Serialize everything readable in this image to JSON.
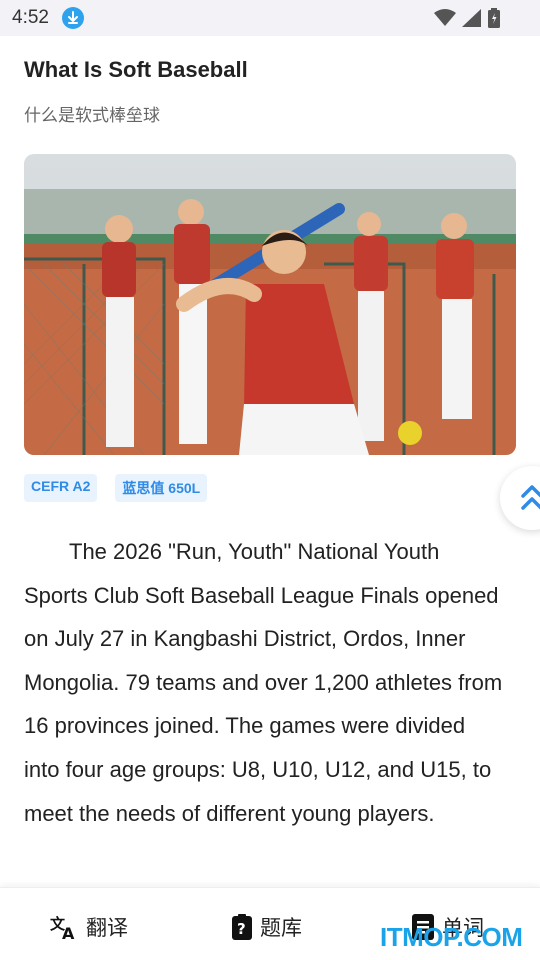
{
  "status_bar": {
    "time": "4:52"
  },
  "article": {
    "title": "What Is Soft Baseball",
    "subtitle": "什么是软式棒垒球",
    "tags": [
      "CEFR A2",
      "蓝思值 650L"
    ],
    "body": "The 2026 \"Run, Youth\" National Youth Sports Club Soft Baseball League Finals opened on July 27 in Kangbashi District, Ordos, Inner Mongolia.  79 teams and over 1,200 athletes from 16 provinces joined. The games were divided into four age groups: U8, U10, U12, and U15, to meet the needs of different young players."
  },
  "bottom_nav": {
    "items": [
      {
        "label": "翻译",
        "icon": "translate-icon"
      },
      {
        "label": "题库",
        "icon": "question-bank-icon"
      },
      {
        "label": "单词",
        "icon": "word-book-icon"
      }
    ]
  },
  "watermark": "ITMOP.COM",
  "colors": {
    "accent": "#2f8be6",
    "tag_bg": "#e8f3fd",
    "status_bg": "#f3f2f7"
  }
}
